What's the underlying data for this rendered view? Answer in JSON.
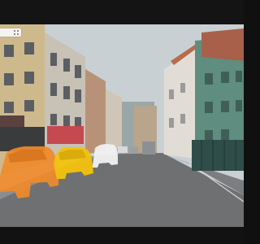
{
  "window": {
    "title": ""
  },
  "address_bar": {
    "text": "",
    "icon": "grid-icon"
  },
  "video": {
    "scene": "street-segmentation",
    "highlight_color": "#f08a2a",
    "vehicles": [
      {
        "label": "",
        "color": "#f08a2a",
        "kind": "suv"
      },
      {
        "label": "",
        "color": "#f2c20e",
        "kind": "hatchback"
      },
      {
        "label": "",
        "color": "#f1f1f1",
        "kind": "van"
      }
    ]
  },
  "colors": {
    "frame_bg": "#101010",
    "sky": "#c8cfd1",
    "road": "#6e6f72",
    "teal_building": "#5c8a7c",
    "left_building": "#cdb88a"
  }
}
